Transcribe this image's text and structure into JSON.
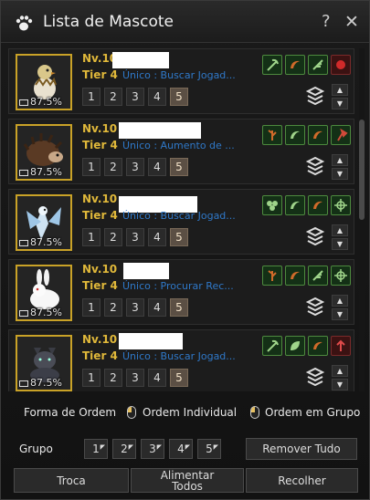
{
  "window": {
    "title": "Lista de Mascote",
    "help_label": "?",
    "close_label": "✕"
  },
  "pets": [
    {
      "level": "Nv.10",
      "tier": "Tier 4",
      "skill": "Único : Buscar Jogad...",
      "percent": "87.5%",
      "order_levels": [
        "1",
        "2",
        "3",
        "4",
        "5"
      ],
      "selected_level": "5",
      "portrait": "hatchling-icon",
      "skill_icons": [
        "pickaxe-icon",
        "sickle-icon",
        "feather-icon",
        "red-orb-icon"
      ]
    },
    {
      "level": "Nv.10",
      "tier": "Tier 4",
      "skill": "Único : Aumento de ...",
      "percent": "87.5%",
      "order_levels": [
        "1",
        "2",
        "3",
        "4",
        "5"
      ],
      "selected_level": "5",
      "portrait": "hedgehog-icon",
      "skill_icons": [
        "branch-icon",
        "sickle-icon",
        "sickle-icon",
        "axe-icon"
      ]
    },
    {
      "level": "Nv.10",
      "tier": "Tier 4",
      "skill": "Único : Buscar Jogad...",
      "percent": "87.5%",
      "order_levels": [
        "1",
        "2",
        "3",
        "4",
        "5"
      ],
      "selected_level": "5",
      "portrait": "ice-bird-icon",
      "skill_icons": [
        "clover-icon",
        "sickle-icon",
        "sickle-icon",
        "crosshair-icon"
      ]
    },
    {
      "level": "Nv.10",
      "tier": "Tier 4",
      "skill": "Único : Procurar Rec...",
      "percent": "87.5%",
      "order_levels": [
        "1",
        "2",
        "3",
        "4",
        "5"
      ],
      "selected_level": "5",
      "portrait": "white-rabbit-icon",
      "skill_icons": [
        "branch-icon",
        "sickle-icon",
        "feather-icon",
        "crosshair-icon"
      ]
    },
    {
      "level": "Nv.10",
      "tier": "Tier 4",
      "skill": "Único : Buscar Jogad...",
      "percent": "87.5%",
      "order_levels": [
        "1",
        "2",
        "3",
        "4",
        "5"
      ],
      "selected_level": "5",
      "portrait": "black-cat-icon",
      "skill_icons": [
        "pickaxe-icon",
        "leaf-icon",
        "sickle-icon",
        "arrow-up-icon"
      ]
    }
  ],
  "order": {
    "label": "Forma de Ordem",
    "individual": "Ordem Individual",
    "group": "Ordem em Grupo"
  },
  "group": {
    "label": "Grupo",
    "buttons": [
      "1",
      "2",
      "3",
      "4",
      "5"
    ],
    "remove_all": "Remover Tudo"
  },
  "bottom": {
    "trade": "Troca",
    "feed_all_line1": "Alimentar",
    "feed_all_line2": "Todos",
    "collect": "Recolher"
  },
  "colors": {
    "level_text": "#e0b83a",
    "skill_text": "#2f78c8",
    "portrait_border": "#c9a227",
    "selected_level_bg": "#5b4f44"
  }
}
